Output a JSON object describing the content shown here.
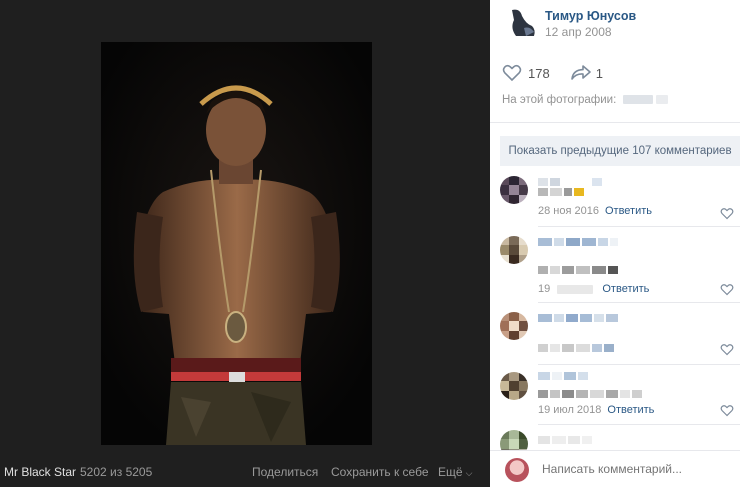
{
  "viewer": {
    "album_name": "Mr Black Star",
    "counter": "5202 из 5205",
    "share_label": "Поделиться",
    "save_label": "Сохранить к себе",
    "more_label": "Ещё"
  },
  "author": {
    "name": "Тимур Юнусов",
    "date": "12 апр 2008"
  },
  "reactions": {
    "likes": "178",
    "shares": "1"
  },
  "photo_description_prefix": "На этой фотографии:",
  "show_previous_label": "Показать предыдущие 107 комментариев",
  "comments": [
    {
      "date": "28 ноя 2016",
      "reply_label": "Ответить"
    },
    {
      "date": "19",
      "reply_label": "Ответить"
    },
    {
      "date": "",
      "reply_label": ""
    },
    {
      "date": "19 июл 2018",
      "reply_label": "Ответить"
    }
  ],
  "compose": {
    "placeholder": "Написать комментарий..."
  },
  "colors": {
    "link_blue": "#2a5885",
    "viewer_bg": "#1f1f1f",
    "button_bg": "#eef1f5"
  }
}
